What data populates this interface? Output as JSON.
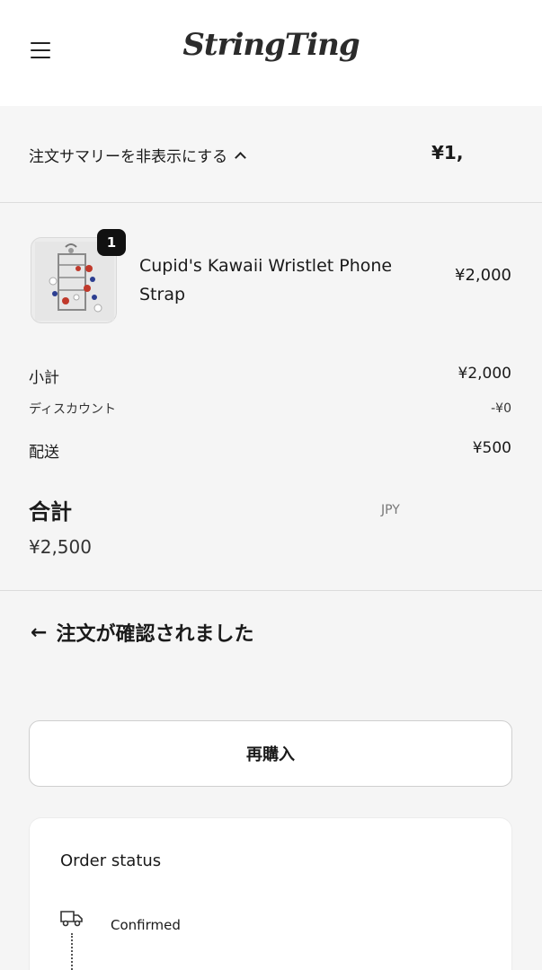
{
  "header": {
    "brand": "StringTing"
  },
  "order_summary": {
    "toggle_label": "注文サマリーを非表示にする",
    "total_short": "¥1,"
  },
  "product": {
    "name": "Cupid's Kawaii Wristlet Phone Strap",
    "quantity": "1",
    "price": "¥2,000"
  },
  "totals": {
    "subtotal_label": "小計",
    "subtotal_value": "¥2,000",
    "discount_label": "ディスカウント",
    "discount_value": "-¥0",
    "shipping_label": "配送",
    "shipping_value": "¥500",
    "total_label": "合計",
    "total_currency": "JPY",
    "total_value": "¥2,500"
  },
  "confirmation": {
    "title": "注文が確認されました"
  },
  "actions": {
    "reorder_label": "再購入"
  },
  "status": {
    "title": "Order status",
    "title_right": "",
    "step_label": "Confirmed",
    "step_sub": ""
  }
}
